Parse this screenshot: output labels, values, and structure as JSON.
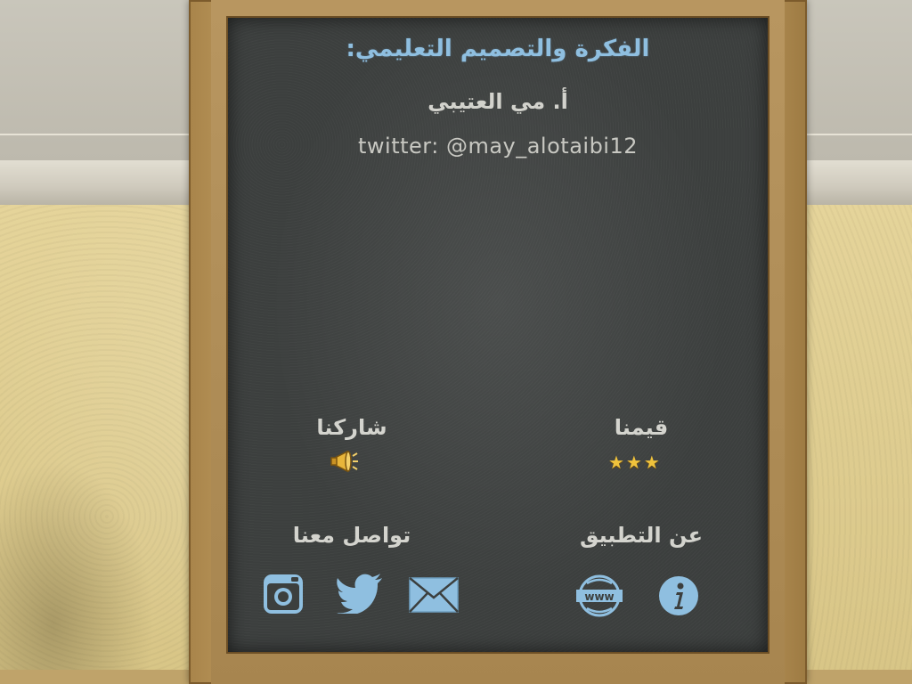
{
  "board": {
    "title": "الفكرة والتصميم التعليمي:",
    "author": "أ. مي العتيبي",
    "twitter_handle": "twitter: @may_alotaibi12"
  },
  "actions": {
    "rate_label": "قيمنا",
    "rating_stars": "★★★",
    "share_label": "شاركنا",
    "about_label": "عن التطبيق",
    "contact_label": "تواصل معنا"
  },
  "icons": {
    "info": "info-icon",
    "website": "www-icon",
    "mail": "mail-icon",
    "twitter": "twitter-icon",
    "instagram": "instagram-icon",
    "megaphone": "megaphone-icon"
  },
  "colors": {
    "chalkboard": "#3c3f3e",
    "accent_blue": "#8fbfe0",
    "chalk_white": "#d2d2cc",
    "star_gold": "#f0c33c"
  }
}
